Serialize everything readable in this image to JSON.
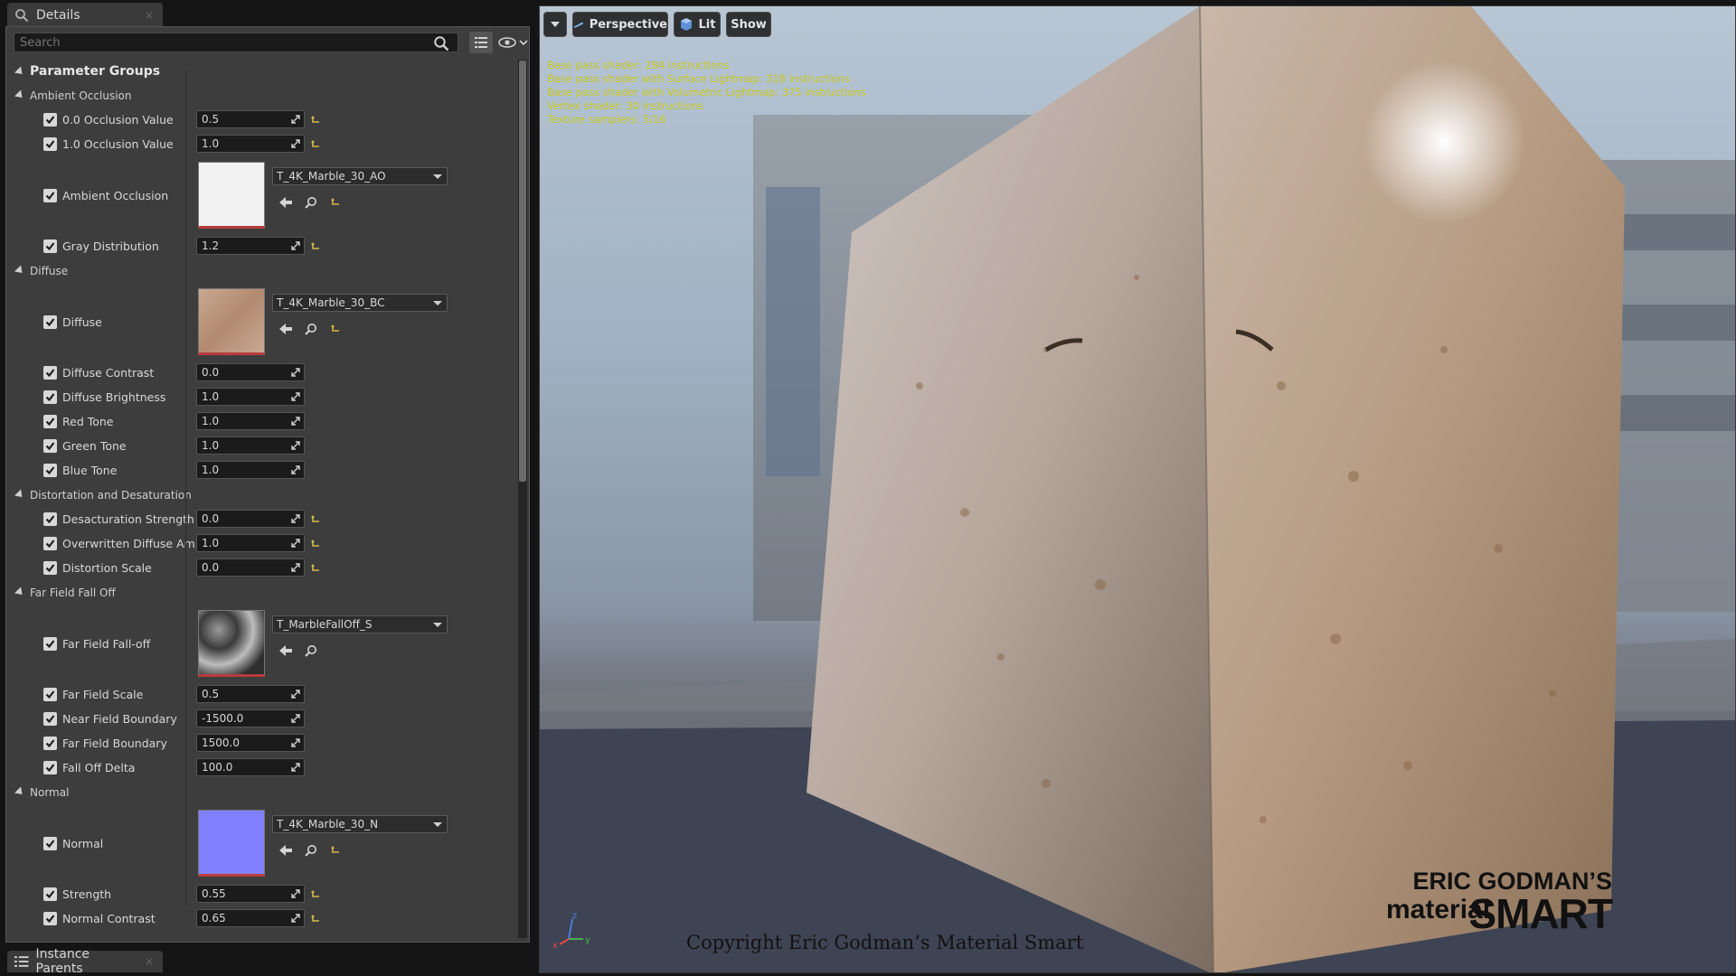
{
  "details_tab": {
    "title": "Details"
  },
  "search": {
    "placeholder": "Search"
  },
  "parameters": {
    "root_label": "Parameter Groups",
    "groups": [
      {
        "label": "Ambient Occlusion",
        "rows": [
          {
            "kind": "scalar",
            "label": "0.0 Occlusion Value",
            "value": "0.5",
            "reset": true
          },
          {
            "kind": "scalar",
            "label": "1.0 Occlusion Value",
            "value": "1.0",
            "reset": true
          },
          {
            "kind": "texture",
            "label": "Ambient Occlusion",
            "texture": "T_4K_Marble_30_AO",
            "swatch": "ao",
            "reset": true
          },
          {
            "kind": "scalar",
            "label": "Gray Distribution",
            "value": "1.2",
            "reset": true
          }
        ]
      },
      {
        "label": "Diffuse",
        "rows": [
          {
            "kind": "texture",
            "label": "Diffuse",
            "texture": "T_4K_Marble_30_BC",
            "swatch": "diffuse",
            "reset": true
          },
          {
            "kind": "scalar",
            "label": "Diffuse Contrast",
            "value": "0.0",
            "reset": false
          },
          {
            "kind": "scalar",
            "label": "Diffuse Brightness",
            "value": "1.0",
            "reset": false
          },
          {
            "kind": "scalar",
            "label": "Red Tone",
            "value": "1.0",
            "reset": false
          },
          {
            "kind": "scalar",
            "label": "Green Tone",
            "value": "1.0",
            "reset": false
          },
          {
            "kind": "scalar",
            "label": "Blue Tone",
            "value": "1.0",
            "reset": false
          }
        ]
      },
      {
        "label": "Distortation and Desaturation",
        "rows": [
          {
            "kind": "scalar",
            "label": "Desacturation Strength",
            "value": "0.0",
            "reset": true
          },
          {
            "kind": "scalar",
            "label": "Overwritten Diffuse Ampl",
            "value": "1.0",
            "reset": true
          },
          {
            "kind": "scalar",
            "label": "Distortion Scale",
            "value": "0.0",
            "reset": true
          }
        ]
      },
      {
        "label": "Far Field Fall Off",
        "rows": [
          {
            "kind": "texture",
            "label": "Far Field Fall-off",
            "texture": "T_MarbleFallOff_S",
            "swatch": "falloff",
            "reset": false
          },
          {
            "kind": "scalar",
            "label": "Far Field Scale",
            "value": "0.5",
            "reset": false
          },
          {
            "kind": "scalar",
            "label": "Near Field Boundary",
            "value": "-1500.0",
            "reset": false
          },
          {
            "kind": "scalar",
            "label": "Far Field Boundary",
            "value": "1500.0",
            "reset": false
          },
          {
            "kind": "scalar",
            "label": "Fall Off Delta",
            "value": "100.0",
            "reset": false
          }
        ]
      },
      {
        "label": "Normal",
        "rows": [
          {
            "kind": "texture",
            "label": "Normal",
            "texture": "T_4K_Marble_30_N",
            "swatch": "normal",
            "reset": true
          },
          {
            "kind": "scalar",
            "label": "Strength",
            "value": "0.55",
            "reset": true
          },
          {
            "kind": "scalar",
            "label": "Normal Contrast",
            "value": "0.65",
            "reset": true
          }
        ]
      }
    ]
  },
  "instance_parents_tab": {
    "title": "Instance Parents"
  },
  "viewport": {
    "perspective_label": "Perspective",
    "lit_label": "Lit",
    "show_label": "Show",
    "stats": [
      "Base pass shader: 284 instructions",
      "Base pass shader with Surface Lightmap: 318 instructions",
      "Base pass shader with Volumetric Lightmap: 375 instructions",
      "Vertex shader: 30 instructions",
      "Texture samplers: 5/16"
    ],
    "copyright": "Copyright Eric Godman’s Material Smart",
    "logo": {
      "top": "ERIC GODMAN’S",
      "left": "material",
      "right": "SMART"
    },
    "axis_labels": {
      "x": "x",
      "y": "y",
      "z": "z"
    }
  },
  "colors": {
    "reset_arrow": "#d7b84a",
    "stats_text": "#c8c81e",
    "normal_swatch": "#8080ff"
  }
}
